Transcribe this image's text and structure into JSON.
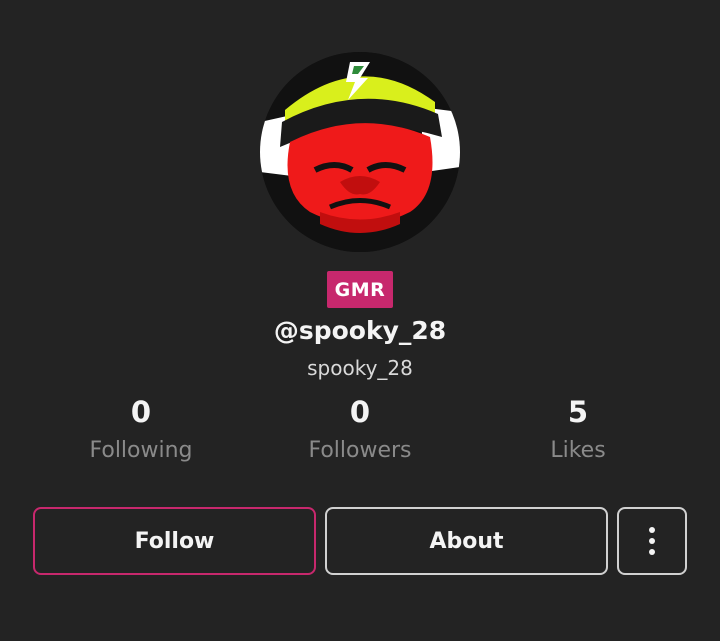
{
  "profile": {
    "badge": "GMR",
    "handle": "@spooky_28",
    "username": "spooky_28"
  },
  "stats": [
    {
      "value": "0",
      "label": "Following"
    },
    {
      "value": "0",
      "label": "Followers"
    },
    {
      "value": "5",
      "label": "Likes"
    }
  ],
  "actions": {
    "follow_label": "Follow",
    "about_label": "About",
    "more_icon": "more-vertical-icon"
  },
  "colors": {
    "background": "#232323",
    "accent": "#c7286d"
  }
}
